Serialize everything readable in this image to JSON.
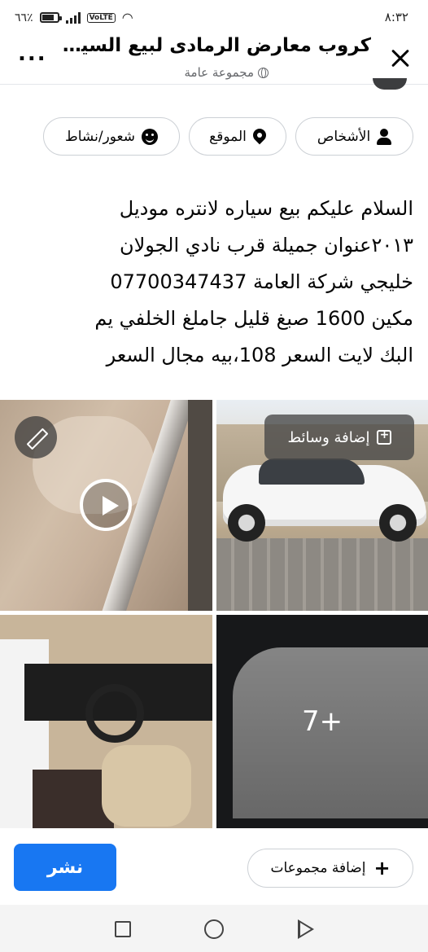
{
  "status_bar": {
    "time": "٨:٣٢",
    "battery": "٦٦٪",
    "volte": "VoLTE"
  },
  "header": {
    "title": "كروب معارض الرمادى لبيع السيا...",
    "subtitle": "مجموعة عامة",
    "more": "..."
  },
  "chips": [
    {
      "label": "الأشخاص",
      "icon": "people-icon"
    },
    {
      "label": "الموقع",
      "icon": "location-pin-icon"
    },
    {
      "label": "شعور/نشاط",
      "icon": "smile-icon"
    }
  ],
  "post": {
    "lines": [
      "السلام عليكم بيع سياره لانتره موديل",
      "٢٠١٣عنوان جميلة قرب نادي الجولان",
      "خليجي شركة العامة 07700347437",
      "مكين 1600 صبغ قليل جاملغ الخلفي يم",
      "البك لايت السعر 108،بيه مجال السعر"
    ]
  },
  "media": {
    "add_media_label": "إضافة وسائط",
    "more_count": "7+"
  },
  "footer": {
    "publish_label": "نشر",
    "add_groups_label": "إضافة مجموعات"
  },
  "colors": {
    "accent": "#1877f2",
    "text": "#050505",
    "secondary_text": "#65676b",
    "chip_border": "#ccd0d5"
  }
}
